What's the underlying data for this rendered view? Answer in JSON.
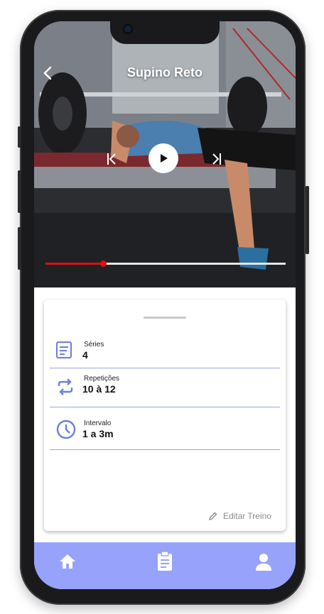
{
  "video": {
    "title": "Supino Reto",
    "progress_fraction": 0.24
  },
  "exercise": {
    "items": [
      {
        "label": "Séries",
        "value": "4"
      },
      {
        "label": "Repetições",
        "value": "10 à 12"
      },
      {
        "label": "Intervalo",
        "value": "1 a 3m"
      }
    ],
    "edit_label": "Editar Treino"
  },
  "nav": {
    "items": [
      "home-icon",
      "clipboard-icon",
      "person-icon"
    ]
  },
  "colors": {
    "accent": "#97a3fa",
    "icon": "#6b7fe0",
    "progress": "#e01010"
  }
}
